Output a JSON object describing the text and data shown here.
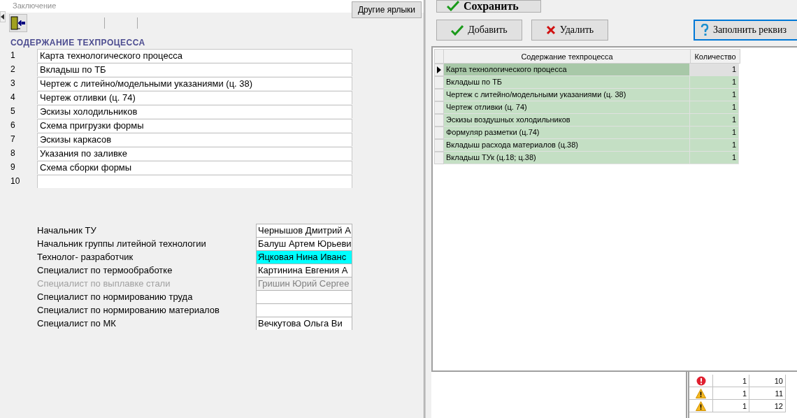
{
  "header": {
    "title": "Заключение",
    "other_tabs_button": "Другие ярлыки"
  },
  "section_title": "СОДЕРЖАНИЕ ТЕХПРОЦЕССА",
  "content_items": [
    {
      "number": "1",
      "value": "Карта технологического процесса"
    },
    {
      "number": "2",
      "value": "Вкладыш по ТБ"
    },
    {
      "number": "3",
      "value": "Чертеж с литейно/модельными указаниями (ц. 38)"
    },
    {
      "number": "4",
      "value": "Чертеж отливки (ц. 74)"
    },
    {
      "number": "5",
      "value": "Эскизы холодильников"
    },
    {
      "number": "6",
      "value": "Схема пригрузки формы"
    },
    {
      "number": "7",
      "value": "Эскизы каркасов"
    },
    {
      "number": "8",
      "value": "Указания по заливке"
    },
    {
      "number": "9",
      "value": "Схема сборки формы"
    },
    {
      "number": "10"
    }
  ],
  "signatories": [
    {
      "role": "Начальник ТУ",
      "name": "Чернышов Дмитрий А",
      "highlighted": false,
      "disabled": false
    },
    {
      "role": "Начальник группы литейной технологии",
      "name": "Балуш Артем Юрьеви",
      "highlighted": false,
      "disabled": false
    },
    {
      "role": "Технолог- разработчик",
      "name": "Яцковая Нина Иванс",
      "highlighted": true,
      "disabled": false
    },
    {
      "role": "Специалист по термообработке",
      "name": "Картинина Евгения А",
      "highlighted": false,
      "disabled": false
    },
    {
      "role": "Специалист по выплавке стали",
      "name": "Гришин Юрий Сергее",
      "highlighted": false,
      "disabled": true
    },
    {
      "role": "Специалист по нормированию труда",
      "highlighted": false,
      "disabled": false
    },
    {
      "role": "Специалист по нормированию материалов",
      "highlighted": false,
      "disabled": false
    },
    {
      "role": "Специалист по МК",
      "name": "Вечкутова Ольга Ви",
      "highlighted": false,
      "disabled": false
    }
  ],
  "toolbar": {
    "save_button": "Сохранить",
    "add_button": "Добавить",
    "delete_button": "Удалить",
    "fill_button": "Заполнить реквиз",
    "fill_focused": true
  },
  "grid": {
    "columns": [
      "Содержание техпроцесса",
      "Количество"
    ],
    "rows": [
      {
        "content": "Карта технологического процесса",
        "quantity": "1",
        "selected": true
      },
      {
        "content": "Вкладыш по ТБ",
        "quantity": "1",
        "selected": false
      },
      {
        "content": "Чертеж с литейно/модельными указаниями (ц. 38)",
        "quantity": "1",
        "selected": false
      },
      {
        "content": "Чертеж отливки (ц. 74)",
        "quantity": "1",
        "selected": false
      },
      {
        "content": "Эскизы воздушных холодильников",
        "quantity": "1",
        "selected": false
      },
      {
        "content": "Формуляр разметки (ц.74)",
        "quantity": "1",
        "selected": false
      },
      {
        "content": "Вкладыш расхода материалов (ц.38)",
        "quantity": "1",
        "selected": false
      },
      {
        "content": "Вкладыш ТУк (ц.18; ц.38)",
        "quantity": "1",
        "selected": false
      }
    ]
  },
  "background_rows": [
    {
      "kind": "error",
      "column_2": "1",
      "column_3": "10"
    },
    {
      "kind": "warning",
      "column_2": "1",
      "column_3": "11"
    },
    {
      "kind": "warning",
      "column_2": "1",
      "column_3": "12"
    }
  ]
}
